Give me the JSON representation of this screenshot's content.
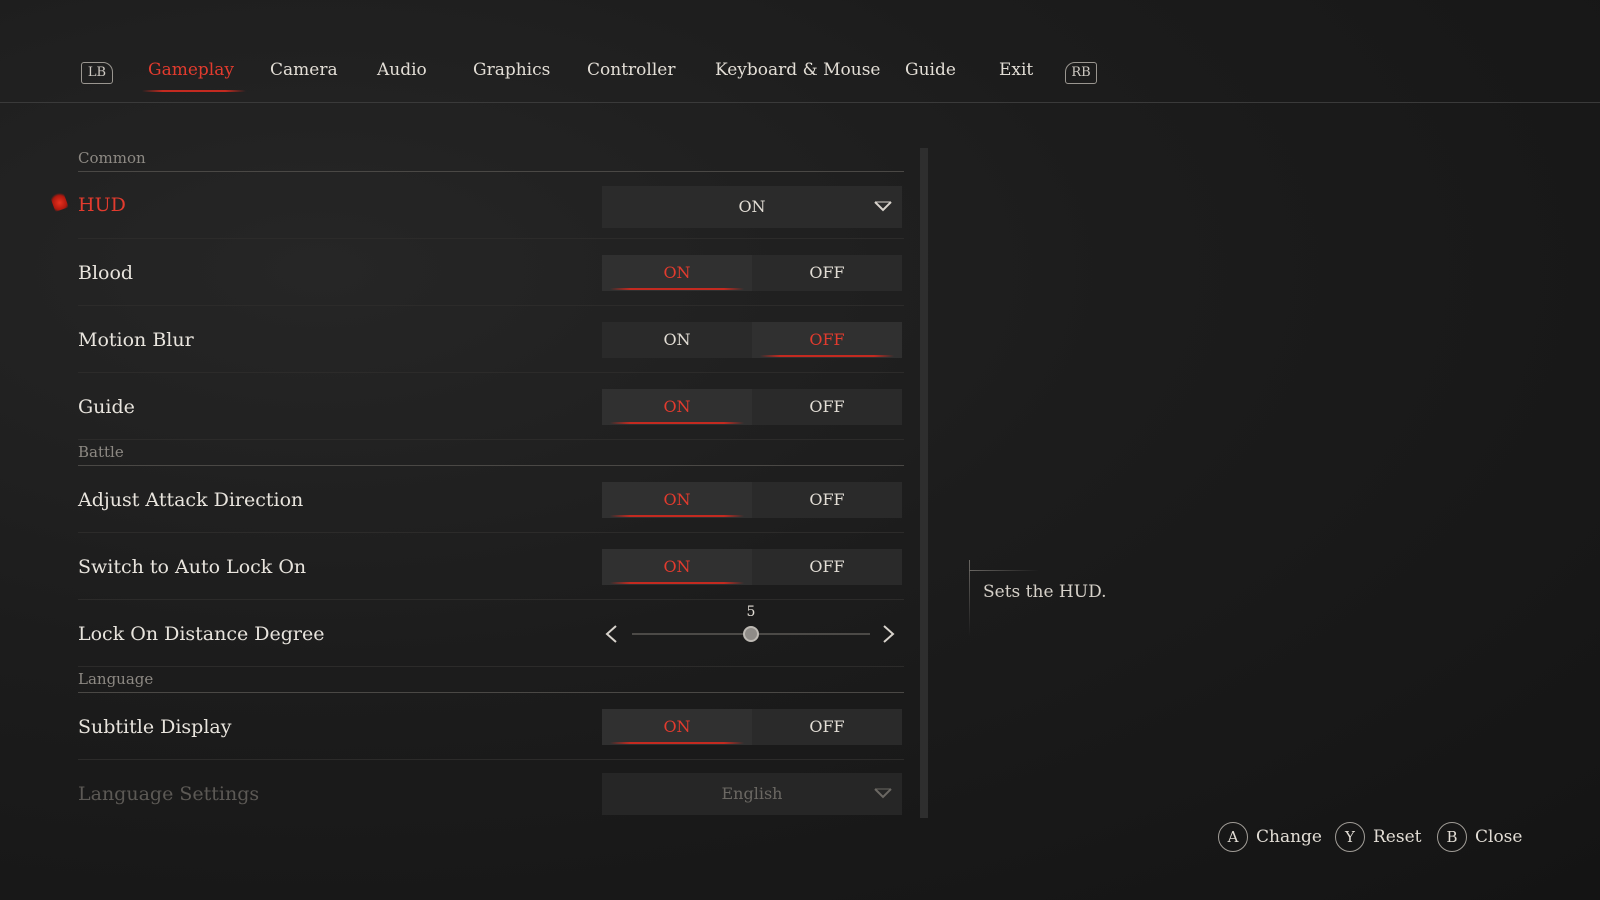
{
  "tabs": {
    "lb": "LB",
    "rb": "RB",
    "items": [
      "Gameplay",
      "Camera",
      "Audio",
      "Graphics",
      "Controller",
      "Keyboard & Mouse",
      "Guide",
      "Exit"
    ],
    "active": "Gameplay"
  },
  "sections": {
    "common": "Common",
    "battle": "Battle",
    "language": "Language"
  },
  "settings": {
    "hud": {
      "label": "HUD",
      "value": "ON"
    },
    "blood": {
      "label": "Blood",
      "on": "ON",
      "off": "OFF",
      "selected": "ON"
    },
    "motion_blur": {
      "label": "Motion Blur",
      "on": "ON",
      "off": "OFF",
      "selected": "OFF"
    },
    "guide": {
      "label": "Guide",
      "on": "ON",
      "off": "OFF",
      "selected": "ON"
    },
    "adjust_attack": {
      "label": "Adjust Attack Direction",
      "on": "ON",
      "off": "OFF",
      "selected": "ON"
    },
    "auto_lock": {
      "label": "Switch to Auto Lock On",
      "on": "ON",
      "off": "OFF",
      "selected": "ON"
    },
    "lock_distance": {
      "label": "Lock On Distance Degree",
      "value": "5",
      "level": 0.5
    },
    "subtitle": {
      "label": "Subtitle Display",
      "on": "ON",
      "off": "OFF",
      "selected": "ON"
    },
    "language": {
      "label": "Language Settings",
      "value": "English"
    }
  },
  "description": "Sets the HUD.",
  "hints": [
    {
      "button": "A",
      "label": "Change"
    },
    {
      "button": "Y",
      "label": "Reset"
    },
    {
      "button": "B",
      "label": "Close"
    }
  ],
  "colors": {
    "accent": "#e23b2e",
    "background": "#1c1c1c",
    "text": "#e4e0da"
  }
}
